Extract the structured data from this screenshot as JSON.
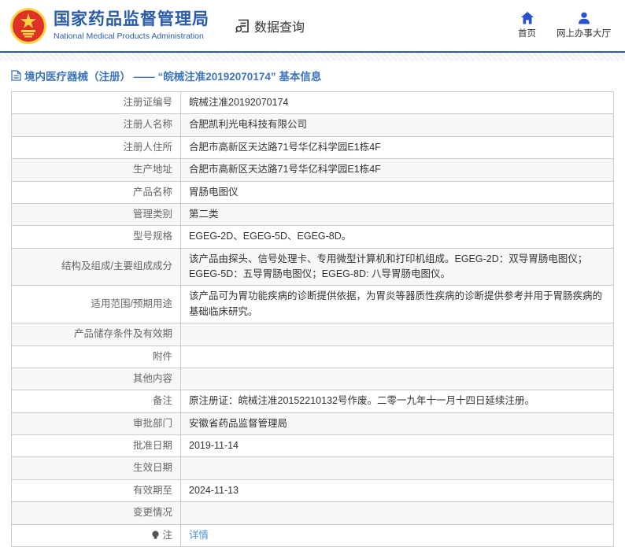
{
  "header": {
    "org_name_cn": "国家药品监督管理局",
    "org_name_en": "National Medical Products Administration",
    "section_label": "数据查询",
    "nav": [
      {
        "label": "首页",
        "icon": "home-icon"
      },
      {
        "label": "网上办事大厅",
        "icon": "user-icon"
      }
    ]
  },
  "breadcrumb": {
    "title": "境内医疗器械（注册） —— “皖械注准20192070174” 基本信息"
  },
  "table": {
    "rows": [
      {
        "label": "注册证编号",
        "value": "皖械注准20192070174"
      },
      {
        "label": "注册人名称",
        "value": "合肥凯利光电科技有限公司"
      },
      {
        "label": "注册人住所",
        "value": "合肥市高新区天达路71号华亿科学园E1栋4F"
      },
      {
        "label": "生产地址",
        "value": "合肥市高新区天达路71号华亿科学园E1栋4F"
      },
      {
        "label": "产品名称",
        "value": "胃肠电图仪"
      },
      {
        "label": "管理类别",
        "value": "第二类"
      },
      {
        "label": "型号规格",
        "value": "EGEG-2D、EGEG-5D、EGEG-8D。"
      },
      {
        "label": "结构及组成/主要组成成分",
        "value": "该产品由探头、信号处理卡、专用微型计算机和打印机组成。EGEG-2D：双导胃肠电图仪；EGEG-5D：五导胃肠电图仪；EGEG-8D: 八导胃肠电图仪。"
      },
      {
        "label": "适用范围/预期用途",
        "value": "该产品可为胃功能疾病的诊断提供依据，为胃炎等器质性疾病的诊断提供参考并用于胃肠疾病的基础临床研究。"
      },
      {
        "label": "产品储存条件及有效期",
        "value": ""
      },
      {
        "label": "附件",
        "value": ""
      },
      {
        "label": "其他内容",
        "value": ""
      },
      {
        "label": "备注",
        "value": "原注册证：皖械注准20152210132号作废。二零一九年十一月十四日延续注册。"
      },
      {
        "label": "审批部门",
        "value": "安徽省药品监督管理局"
      },
      {
        "label": "批准日期",
        "value": "2019-11-14"
      },
      {
        "label": "生效日期",
        "value": ""
      },
      {
        "label": "有效期至",
        "value": "2024-11-13"
      },
      {
        "label": "变更情况",
        "value": ""
      },
      {
        "label": "注",
        "value": "详情",
        "label_icon": "note-icon",
        "value_is_link": true
      }
    ]
  },
  "colors": {
    "brand_blue": "#2a5caa",
    "nav_icon_blue": "#2b52cc",
    "title_blue": "#3d74bc",
    "link_blue": "#4a90e2",
    "stripe_gray": "#f7f7f7",
    "border_gray": "#cccccc",
    "emblem_red": "#de3226",
    "emblem_gold": "#f7d547"
  }
}
